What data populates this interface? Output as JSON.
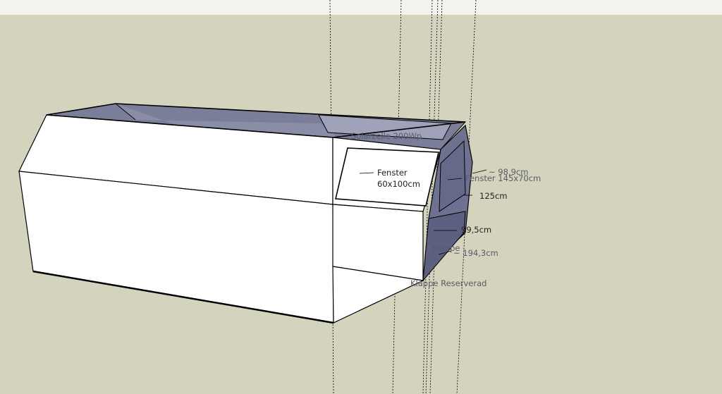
{
  "scene": {
    "colors": {
      "sky": "#f3f3ee",
      "ground": "#d4d3bd",
      "face_light": "#ffffff",
      "face_shade": "#7b7e99",
      "face_dark": "#5d6080",
      "edge": "#000000",
      "guide": "#000000"
    }
  },
  "labels": {
    "fenster_front_line1": "Fenster",
    "fenster_front_line2": "60x100cm",
    "solarzelle": "Solarzelle 200Wp",
    "tilde_98_9": "~ 98,9cm",
    "fenster_rear": "Fenster 145x70cm",
    "dim_125": "125cm",
    "dim_99_5": "99,5cm",
    "klappe": "Klappe",
    "dim_194_3": "~ 194,3cm",
    "klappe_reserverad": "Klappe Reserverad"
  }
}
